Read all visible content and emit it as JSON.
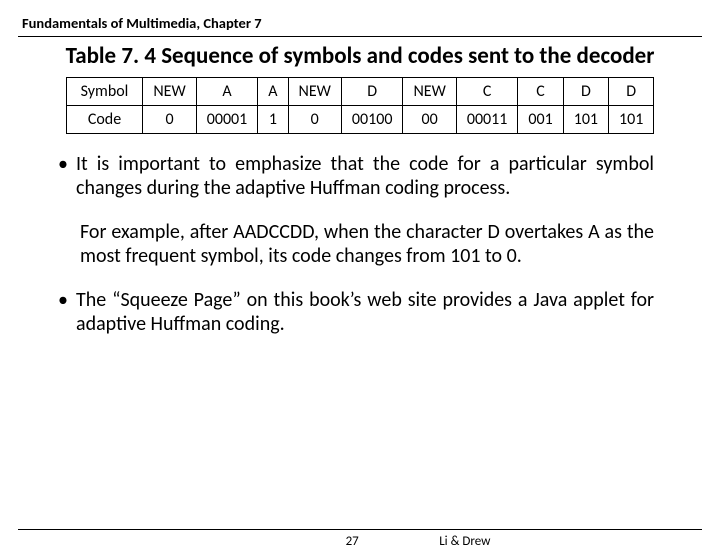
{
  "chapter": "Fundamentals of Multimedia, Chapter 7",
  "table": {
    "caption": "Table 7. 4 Sequence of symbols and codes sent to the decoder",
    "row_labels": [
      "Symbol",
      "Code"
    ],
    "columns": [
      {
        "symbol": "NEW",
        "code": "0"
      },
      {
        "symbol": "A",
        "code": "00001"
      },
      {
        "symbol": "A",
        "code": "1"
      },
      {
        "symbol": "NEW",
        "code": "0"
      },
      {
        "symbol": "D",
        "code": "00100"
      },
      {
        "symbol": "NEW",
        "code": "00"
      },
      {
        "symbol": "C",
        "code": "00011"
      },
      {
        "symbol": "C",
        "code": "001"
      },
      {
        "symbol": "D",
        "code": "101"
      },
      {
        "symbol": "D",
        "code": "101"
      }
    ]
  },
  "bullets": {
    "b1": "It is important to emphasize that the code for a particular symbol changes during the adaptive Huffman coding process.",
    "b1b": "For example, after AADCCDD, when the character D overtakes A as the most frequent symbol, its code changes from 101 to 0.",
    "b2": "The “Squeeze Page” on this book’s web site provides a Java applet for adaptive Huffman coding."
  },
  "footer": {
    "page": "27",
    "authors": "Li & Drew"
  }
}
